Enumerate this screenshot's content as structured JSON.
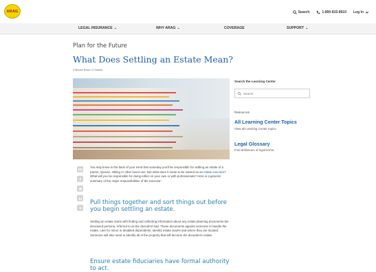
{
  "brand": {
    "logo_text": "ARAG",
    "logo_bg": "#f6d400",
    "logo_text_color": "#9b1b20"
  },
  "top_links": {
    "search": "Search",
    "phone": "1-800-815-8010",
    "login": "Log In"
  },
  "nav": {
    "items": [
      {
        "label": "LEGAL INSURANCE"
      },
      {
        "label": "WHY ARAG"
      },
      {
        "label": "COVERAGE"
      },
      {
        "label": "SUPPORT"
      }
    ]
  },
  "article": {
    "subtitle": "Plan for the Future",
    "title": "What Does Settling an Estate Mean?",
    "meta": "3 Minute Read  •  0 Shares",
    "intro_1": "You may know in the back of your mind that someday you'll be responsible for settling an estate of a parent, spouse, sibling or other loved one. But what does it mean to be named as an ",
    "intro_link": "estate executor",
    "intro_2": "? What will you be responsible for doing either on your own or with professionals? Here is a general summary of the major responsibilities of the executor:",
    "heading_1": "Pull things together and sort things out before you begin settling an estate.",
    "para_2": "Settling an estate starts with finding and collecting information about any estate planning documents the deceased persona, referred to as the decedent had. These documents appoint someone to handle the estate, care for minor or disabled dependents, identify estate assets and where they are located. Someone will also need to identify all of the property that will become the decedent's estate.",
    "heading_2": "Ensure estate fiduciaries have formal authority to act."
  },
  "sidebar": {
    "search_label": "Search the Learning Center",
    "search_placeholder": "Search",
    "resources_label": "Resources",
    "links": [
      {
        "title": "All Learning Center Topics",
        "desc": "View all Learning Center topics."
      },
      {
        "title": "Legal Glossary",
        "desc": "Find definitions of legal terms."
      }
    ]
  },
  "share_icons": [
    "email-icon",
    "facebook-icon",
    "twitter-icon",
    "linkedin-icon",
    "plus-icon"
  ],
  "colors": {
    "link_blue": "#1b5fa7",
    "heading_blue": "#2a7fb3",
    "nav_bg": "#f3f3f3"
  }
}
